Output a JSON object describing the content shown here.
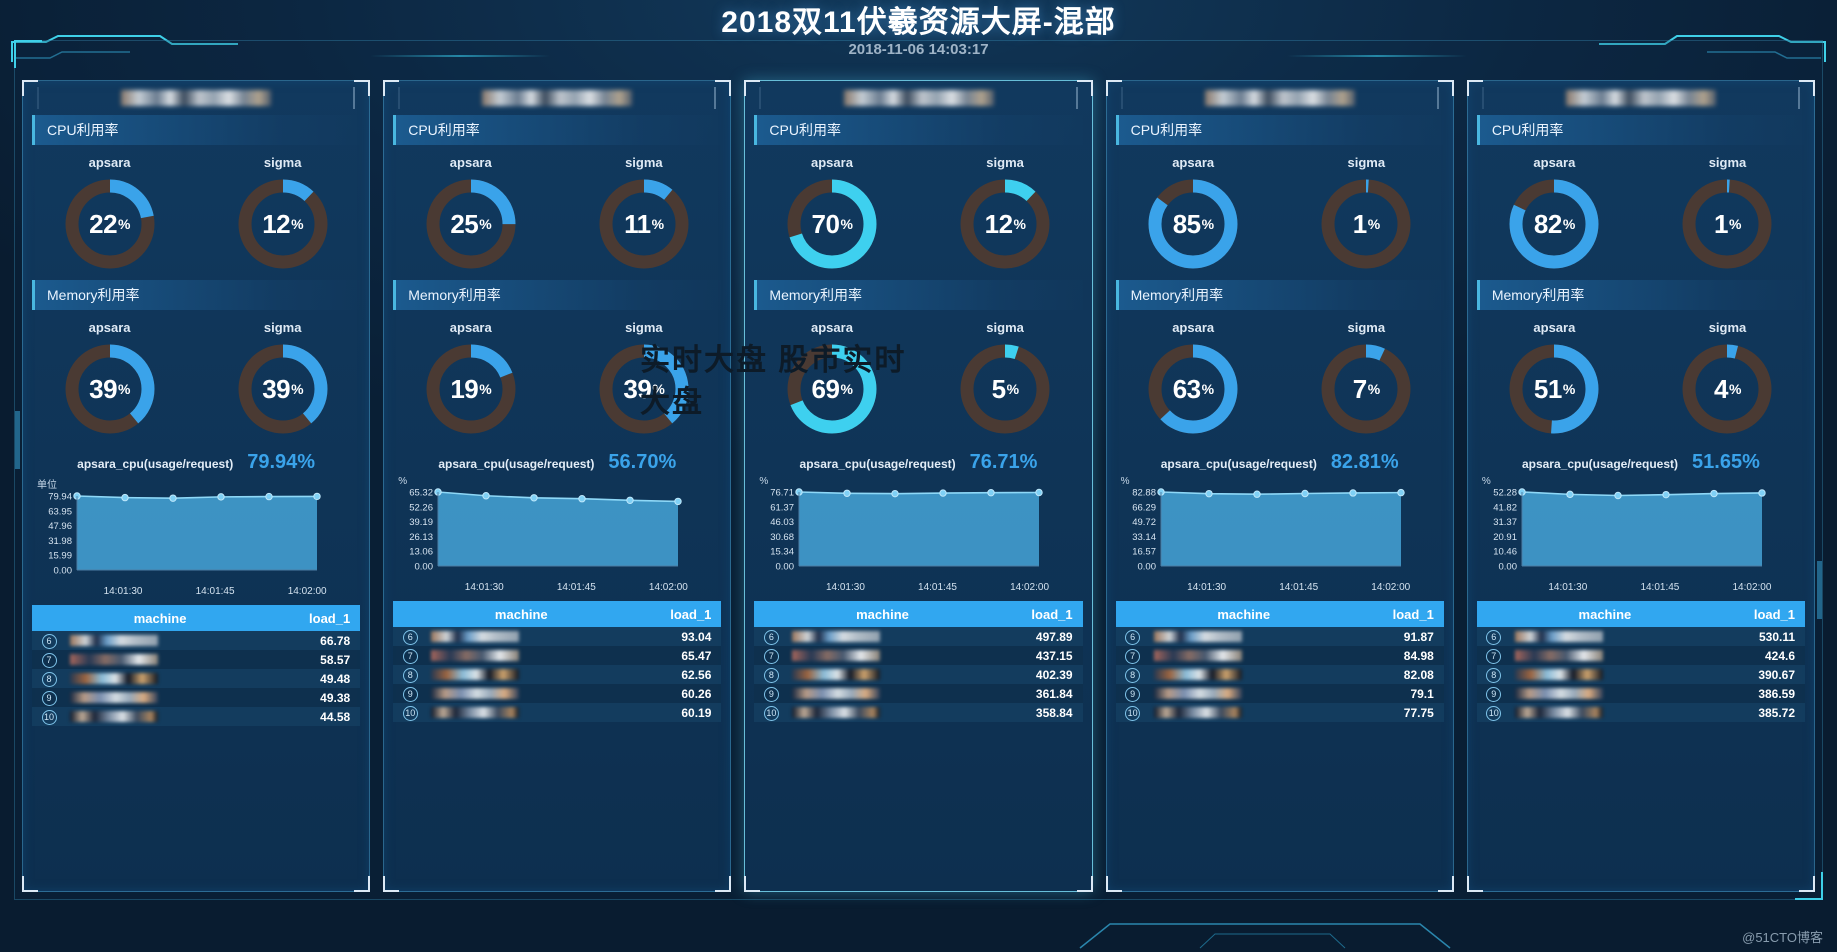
{
  "header": {
    "title": "2018双11伏羲资源大屏-混部",
    "timestamp": "2018-11-06 14:03:17"
  },
  "section_labels": {
    "cpu": "CPU利用率",
    "memory": "Memory利用率"
  },
  "gauge_labels": {
    "apsara": "apsara",
    "sigma": "sigma"
  },
  "table_headers": {
    "index": "",
    "machine": "machine",
    "load": "load_1"
  },
  "axis": {
    "x_ticks": [
      "14:01:30",
      "14:01:45",
      "14:02:00"
    ]
  },
  "watermarks": {
    "center": "实时大盘 股市实时大盘",
    "corner": "@51CTO博客"
  },
  "colors": {
    "accent": "#31a7f0",
    "ring_active": "#3aa3ea",
    "ring_active_bright": "#3ed0ef",
    "ring_track": "#4a3a33",
    "value_text": "#3aa3ea",
    "panel_bg": "#0d2f4f"
  },
  "panels": [
    {
      "featured": false,
      "cpu": {
        "apsara": 22,
        "sigma": 12
      },
      "memory": {
        "apsara": 39,
        "sigma": 39
      },
      "chart": {
        "name": "apsara_cpu(usage/request)",
        "value": "79.94%",
        "unit": "单位",
        "y_ticks": [
          "79.94",
          "63.95",
          "47.96",
          "31.98",
          "15.99",
          "0.00"
        ],
        "ymax": 79.94,
        "points": [
          79.94,
          78.2,
          77.6,
          79.0,
          79.3,
          79.5
        ]
      },
      "rows": [
        {
          "index": "6",
          "load": "66.78"
        },
        {
          "index": "7",
          "load": "58.57"
        },
        {
          "index": "8",
          "load": "49.48"
        },
        {
          "index": "9",
          "load": "49.38"
        },
        {
          "index": "10",
          "load": "44.58"
        }
      ]
    },
    {
      "featured": false,
      "cpu": {
        "apsara": 25,
        "sigma": 11
      },
      "memory": {
        "apsara": 19,
        "sigma": 39
      },
      "chart": {
        "name": "apsara_cpu(usage/request)",
        "value": "56.70%",
        "unit": "%",
        "y_ticks": [
          "65.32",
          "52.26",
          "39.19",
          "26.13",
          "13.06",
          "0.00"
        ],
        "ymax": 65.32,
        "points": [
          65.32,
          62.0,
          60.2,
          59.4,
          58.0,
          57.0
        ]
      },
      "rows": [
        {
          "index": "6",
          "load": "93.04"
        },
        {
          "index": "7",
          "load": "65.47"
        },
        {
          "index": "8",
          "load": "62.56"
        },
        {
          "index": "9",
          "load": "60.26"
        },
        {
          "index": "10",
          "load": "60.19"
        }
      ]
    },
    {
      "featured": true,
      "cpu": {
        "apsara": 70,
        "sigma": 12
      },
      "memory": {
        "apsara": 69,
        "sigma": 5
      },
      "chart": {
        "name": "apsara_cpu(usage/request)",
        "value": "76.71%",
        "unit": "%",
        "y_ticks": [
          "76.71",
          "61.37",
          "46.03",
          "30.68",
          "15.34",
          "0.00"
        ],
        "ymax": 76.71,
        "points": [
          76.71,
          75.4,
          75.0,
          75.6,
          76.0,
          76.2
        ]
      },
      "rows": [
        {
          "index": "6",
          "load": "497.89"
        },
        {
          "index": "7",
          "load": "437.15"
        },
        {
          "index": "8",
          "load": "402.39"
        },
        {
          "index": "9",
          "load": "361.84"
        },
        {
          "index": "10",
          "load": "358.84"
        }
      ]
    },
    {
      "featured": false,
      "cpu": {
        "apsara": 85,
        "sigma": 1
      },
      "memory": {
        "apsara": 63,
        "sigma": 7
      },
      "chart": {
        "name": "apsara_cpu(usage/request)",
        "value": "82.81%",
        "unit": "%",
        "y_ticks": [
          "82.88",
          "66.29",
          "49.72",
          "33.14",
          "16.57",
          "0.00"
        ],
        "ymax": 82.88,
        "points": [
          82.88,
          81.0,
          80.4,
          81.2,
          81.8,
          82.2
        ]
      },
      "rows": [
        {
          "index": "6",
          "load": "91.87"
        },
        {
          "index": "7",
          "load": "84.98"
        },
        {
          "index": "8",
          "load": "82.08"
        },
        {
          "index": "9",
          "load": "79.1"
        },
        {
          "index": "10",
          "load": "77.75"
        }
      ]
    },
    {
      "featured": false,
      "cpu": {
        "apsara": 82,
        "sigma": 1
      },
      "memory": {
        "apsara": 51,
        "sigma": 4
      },
      "chart": {
        "name": "apsara_cpu(usage/request)",
        "value": "51.65%",
        "unit": "%",
        "y_ticks": [
          "52.28",
          "41.82",
          "31.37",
          "20.91",
          "10.46",
          "0.00"
        ],
        "ymax": 52.28,
        "points": [
          52.28,
          50.6,
          49.8,
          50.4,
          51.2,
          51.6
        ]
      },
      "rows": [
        {
          "index": "6",
          "load": "530.11"
        },
        {
          "index": "7",
          "load": "424.6"
        },
        {
          "index": "8",
          "load": "390.67"
        },
        {
          "index": "9",
          "load": "386.59"
        },
        {
          "index": "10",
          "load": "385.72"
        }
      ]
    }
  ]
}
